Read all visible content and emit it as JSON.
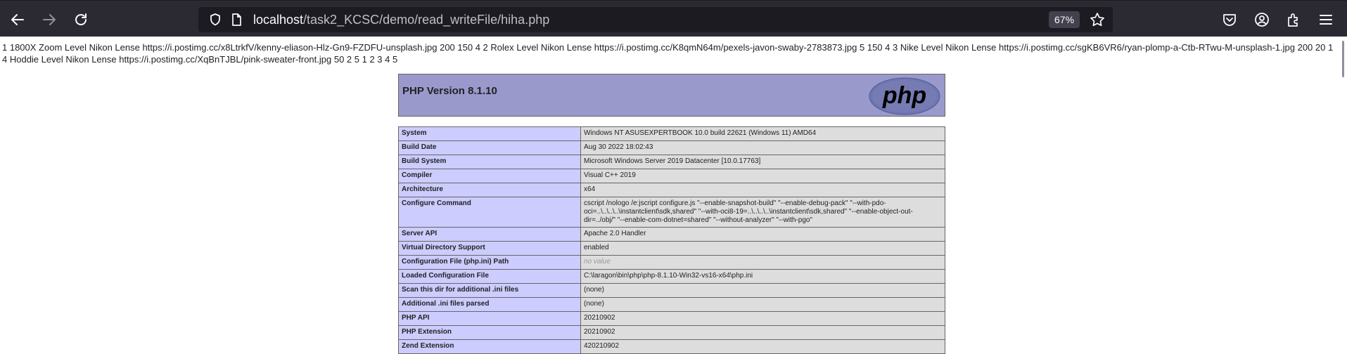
{
  "browser": {
    "url_host": "localhost",
    "url_path": "/task2_KCSC/demo/read_writeFile/hiha.php",
    "zoom": "67%"
  },
  "page": {
    "output_text": "1 1800X Zoom Level Nikon Lense https://i.postimg.cc/x8LtrkfV/kenny-eliason-Hlz-Gn9-FZDFU-unsplash.jpg 200 150 4 2 Rolex Level Nikon Lense https://i.postimg.cc/K8qmN64m/pexels-javon-swaby-2783873.jpg 5 150 4 3 Nike Level Nikon Lense https://i.postimg.cc/sgKB6VR6/ryan-plomp-a-Ctb-RTwu-M-unsplash-1.jpg 200 20 1 4 Hoddie Level Nikon Lense https://i.postimg.cc/XqBnTJBL/pink-sweater-front.jpg 50 2 5 1 2 3 4 5"
  },
  "phpinfo": {
    "version_title": "PHP Version 8.1.10",
    "rows": [
      {
        "key": "System",
        "value": "Windows NT ASUSEXPERTBOOK 10.0 build 22621 (Windows 11) AMD64"
      },
      {
        "key": "Build Date",
        "value": "Aug 30 2022 18:02:43"
      },
      {
        "key": "Build System",
        "value": "Microsoft Windows Server 2019 Datacenter [10.0.17763]"
      },
      {
        "key": "Compiler",
        "value": "Visual C++ 2019"
      },
      {
        "key": "Architecture",
        "value": "x64"
      },
      {
        "key": "Configure Command",
        "value": "cscript /nologo /e:jscript configure.js \"--enable-snapshot-build\" \"--enable-debug-pack\" \"--with-pdo-oci=..\\..\\..\\..\\instantclient\\sdk,shared\" \"--with-oci8-19=..\\..\\..\\..\\instantclient\\sdk,shared\" \"--enable-object-out-dir=../obj/\" \"--enable-com-dotnet=shared\" \"--without-analyzer\" \"--with-pgo\""
      },
      {
        "key": "Server API",
        "value": "Apache 2.0 Handler"
      },
      {
        "key": "Virtual Directory Support",
        "value": "enabled"
      },
      {
        "key": "Configuration File (php.ini) Path",
        "value": "no value"
      },
      {
        "key": "Loaded Configuration File",
        "value": "C:\\laragon\\bin\\php\\php-8.1.10-Win32-vs16-x64\\php.ini"
      },
      {
        "key": "Scan this dir for additional .ini files",
        "value": "(none)"
      },
      {
        "key": "Additional .ini files parsed",
        "value": "(none)"
      },
      {
        "key": "PHP API",
        "value": "20210902"
      },
      {
        "key": "PHP Extension",
        "value": "20210902"
      },
      {
        "key": "Zend Extension",
        "value": "420210902"
      }
    ]
  }
}
